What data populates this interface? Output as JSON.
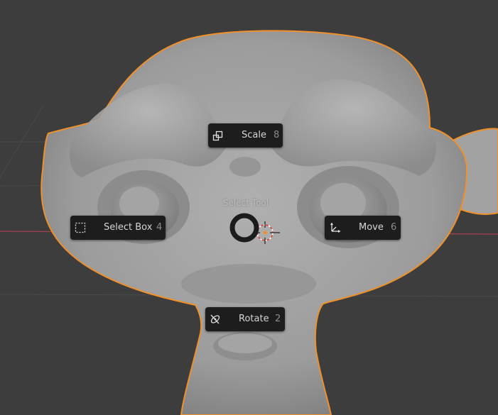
{
  "pie_menu": {
    "title": "Select Tool",
    "items": [
      {
        "label": "Scale",
        "shortcut": "8",
        "icon": "scale-icon"
      },
      {
        "label": "Select Box",
        "shortcut": "4",
        "icon": "select-box-icon"
      },
      {
        "label": "Move",
        "shortcut": "6",
        "icon": "move-icon"
      },
      {
        "label": "Rotate",
        "shortcut": "2",
        "icon": "rotate-icon"
      }
    ]
  },
  "viewport": {
    "object": "monkey-mesh",
    "background_color": "#3d3d3d",
    "mesh_color": "#9a9a9a",
    "outline_color": "#f0902a",
    "x_axis_color": "#a8404a",
    "y_axis_color": "#6a8f3a"
  }
}
